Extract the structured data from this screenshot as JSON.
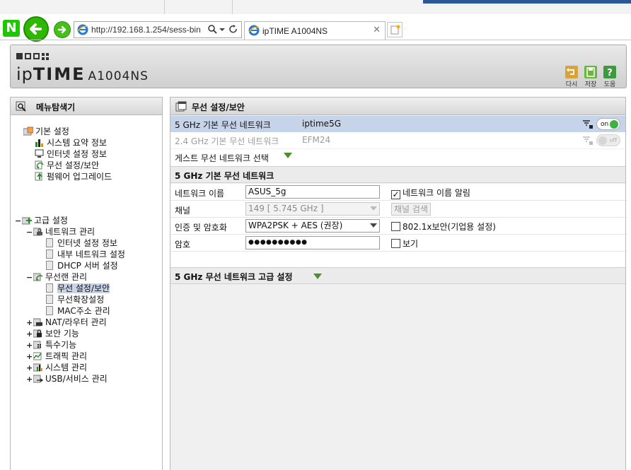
{
  "browser": {
    "nav_logo": "N",
    "address": "http://192.168.1.254/sess-bin",
    "tab_title": "ipTIME A1004NS"
  },
  "header": {
    "brand_ip": "ip",
    "brand_time": "TIME",
    "model": "A1004NS",
    "buttons": [
      {
        "label": "다시",
        "color": "#d8a33a"
      },
      {
        "label": "저장",
        "color": "#6db33f"
      },
      {
        "label": "도움",
        "color": "#3f9a3f"
      }
    ]
  },
  "menu": {
    "title": "메뉴탐색기",
    "basic": {
      "label": "기본 설정",
      "items": [
        "시스템 요약 정보",
        "인터넷 설정 정보",
        "무선 설정/보안",
        "펌웨어 업그레이드"
      ]
    },
    "advanced": {
      "toggle": "−",
      "label": "고급 설정",
      "network": {
        "label": "네트워크 관리",
        "items": [
          "인터넷 설정 정보",
          "내부 네트워크 설정",
          "DHCP 서버 설정"
        ]
      },
      "wireless": {
        "label": "무선랜 관리",
        "items": [
          "무선 설정/보안",
          "무선확장설정",
          "MAC주소 관리"
        ]
      },
      "groups": [
        "NAT/라우터 관리",
        "보안 기능",
        "특수기능",
        "트래픽 관리",
        "시스템 관리",
        "USB/서비스 관리"
      ]
    }
  },
  "panel": {
    "title": "무선 설정/보안",
    "networks": [
      {
        "band": "5 GHz 기본 무선 네트워크",
        "ssid": "iptime5G",
        "toggle": "on"
      },
      {
        "band": "2.4 GHz 기본 무선 네트워크",
        "ssid": "EFM24",
        "toggle": "off"
      }
    ],
    "guest_label": "게스트 무선 네트워크 선택",
    "basic_section": "5 GHz 기본 무선 네트워크",
    "fields": {
      "name_label": "네트워크 이름",
      "name_value": "ASUS_5g",
      "broadcast_label": "네트워크 이름 알림",
      "broadcast_checked": "✓",
      "channel_label": "채널",
      "channel_value": "149 [ 5.745 GHz ]",
      "channel_search": "채널 검색",
      "auth_label": "인증 및 암호화",
      "auth_value": "WPA2PSK + AES (권장)",
      "enterprise_label": "802.1x보안(기업용 설정)",
      "password_label": "암호",
      "password_value": "●●●●●●●●●●",
      "show_label": "보기"
    },
    "advanced_section": "5 GHz 무선 네트워크 고급 설정"
  }
}
